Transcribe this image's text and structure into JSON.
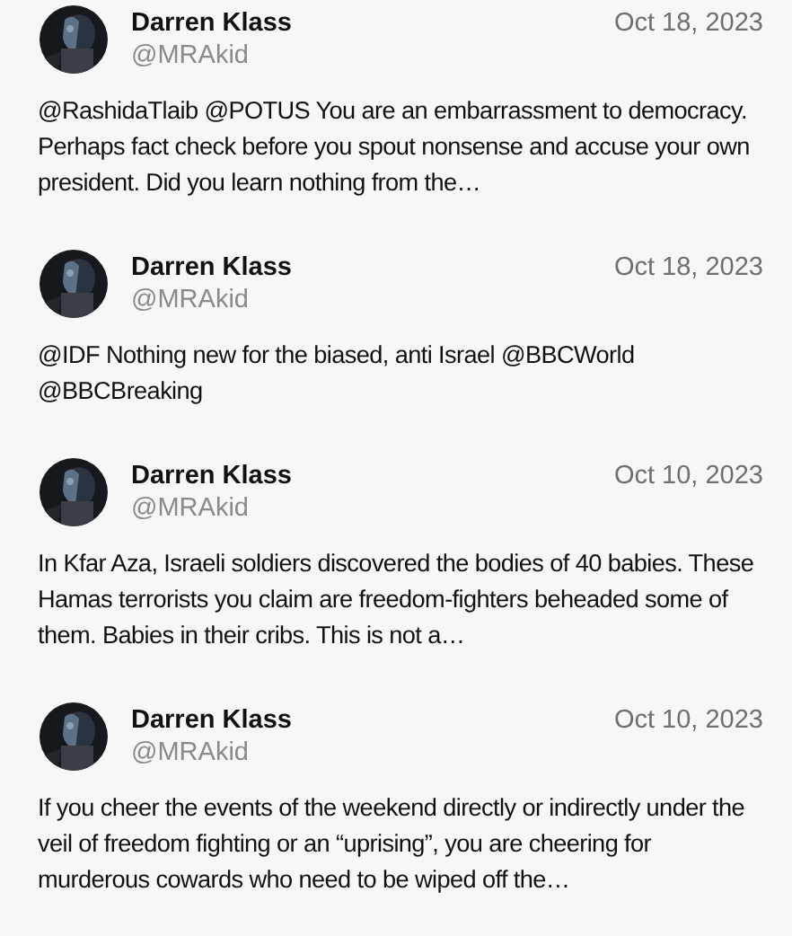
{
  "tweets": [
    {
      "name": "Darren Klass",
      "handle": "@MRAkid",
      "date": "Oct 18, 2023",
      "text": "@RashidaTlaib @POTUS You are an embarrassment to democracy. Perhaps fact check before you spout nonsense and accuse your own president. Did you learn nothing from the…"
    },
    {
      "name": "Darren Klass",
      "handle": "@MRAkid",
      "date": "Oct 18, 2023",
      "text": "@IDF Nothing new for the biased, anti Israel @BBCWorld @BBCBreaking"
    },
    {
      "name": "Darren Klass",
      "handle": "@MRAkid",
      "date": "Oct 10, 2023",
      "text": "In Kfar Aza, Israeli soldiers discovered the bodies of 40 babies. These Hamas terrorists you claim are freedom-fighters beheaded some of them. Babies in their cribs. This is not a…"
    },
    {
      "name": "Darren Klass",
      "handle": "@MRAkid",
      "date": "Oct 10, 2023",
      "text": "If you cheer the events of the weekend directly or indirectly under the veil of freedom fighting or an “uprising”, you are cheering for murderous cowards who need to be wiped off the…"
    }
  ]
}
